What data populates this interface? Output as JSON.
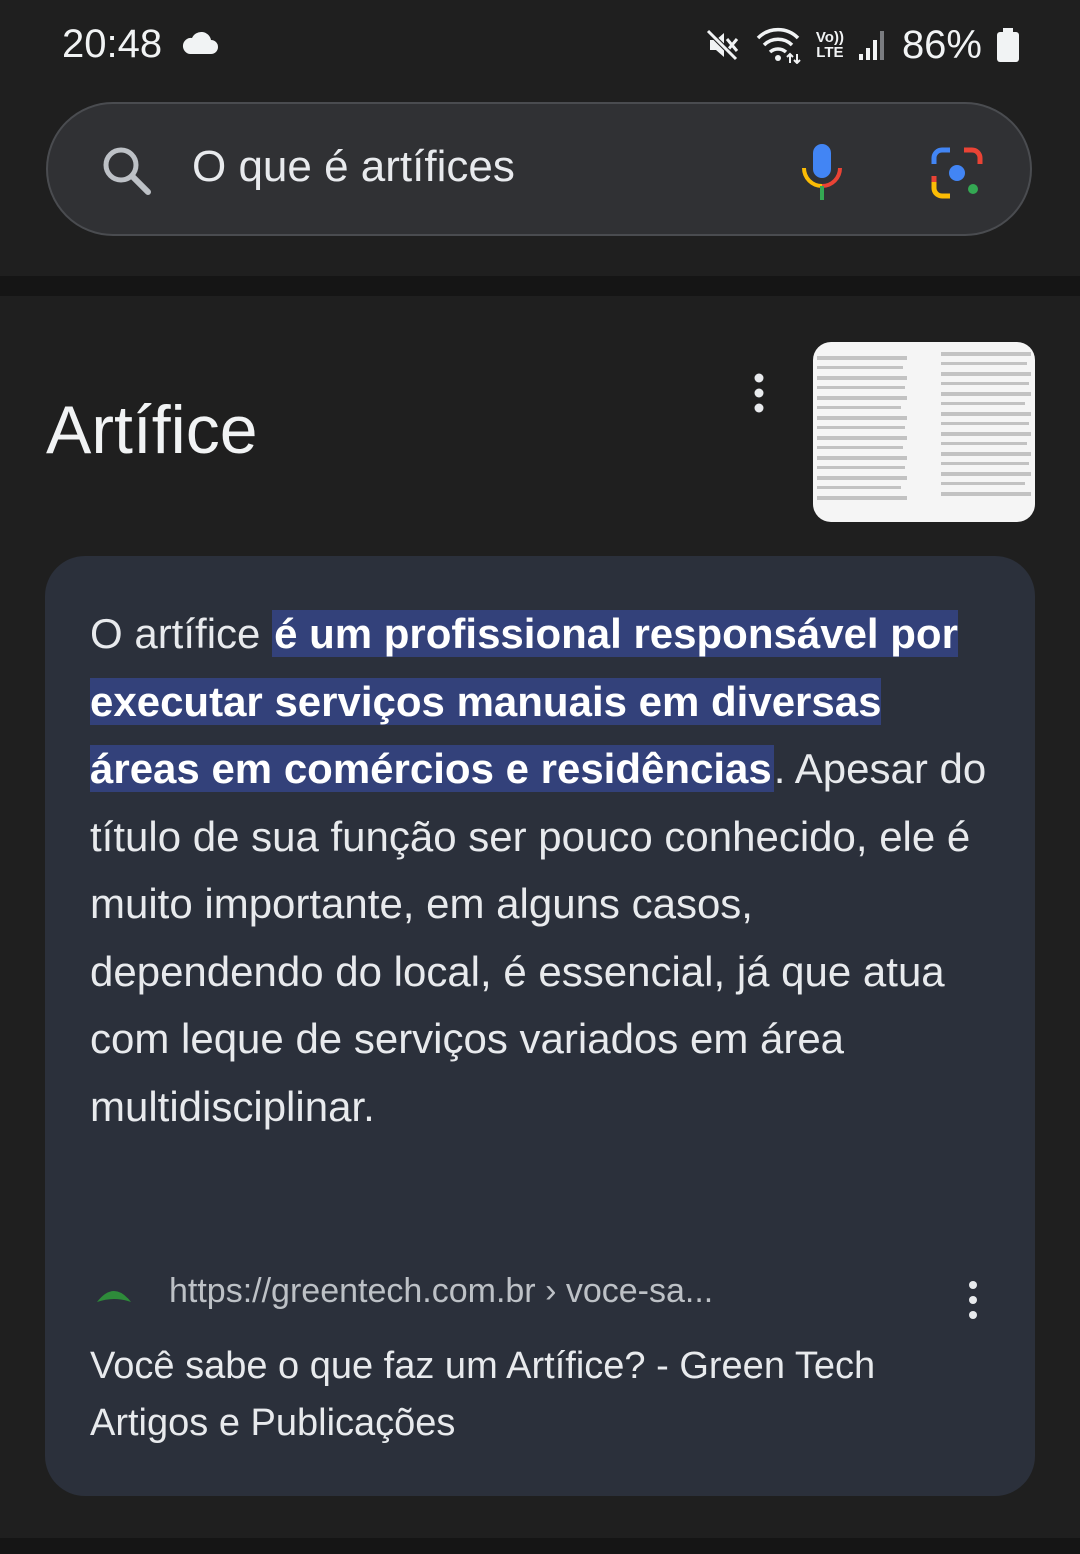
{
  "status_bar": {
    "time": "20:48",
    "volte_top": "Vo))",
    "volte_bottom": "LTE",
    "battery": "86%",
    "icons": [
      "cloud-icon",
      "mute-icon",
      "wifi-icon",
      "volte-icon",
      "signal-icon",
      "battery-icon"
    ]
  },
  "search": {
    "query": "O que é artífices",
    "icons": [
      "search-icon",
      "mic-icon",
      "lens-icon"
    ]
  },
  "result": {
    "title": "Artífice",
    "snippet_before": "O artífice ",
    "snippet_highlight": "é um profissional responsável por executar serviços manuais em diversas áreas em comércios e residências",
    "snippet_after": ". Apesar do título de sua função ser pouco conhecido, ele é muito importante, em alguns casos, dependendo do local, é essencial, já que atua com leque de serviços variados em área multidisciplinar.",
    "source_url": "https://greentech.com.br › voce-sa...",
    "source_title": "Você sabe o que faz um Artífice? - Green Tech Artigos e Publicações"
  },
  "colors": {
    "background": "#1f1f1f",
    "card": "#2b303b",
    "highlight": "#33417a",
    "search_bar": "#303134"
  }
}
